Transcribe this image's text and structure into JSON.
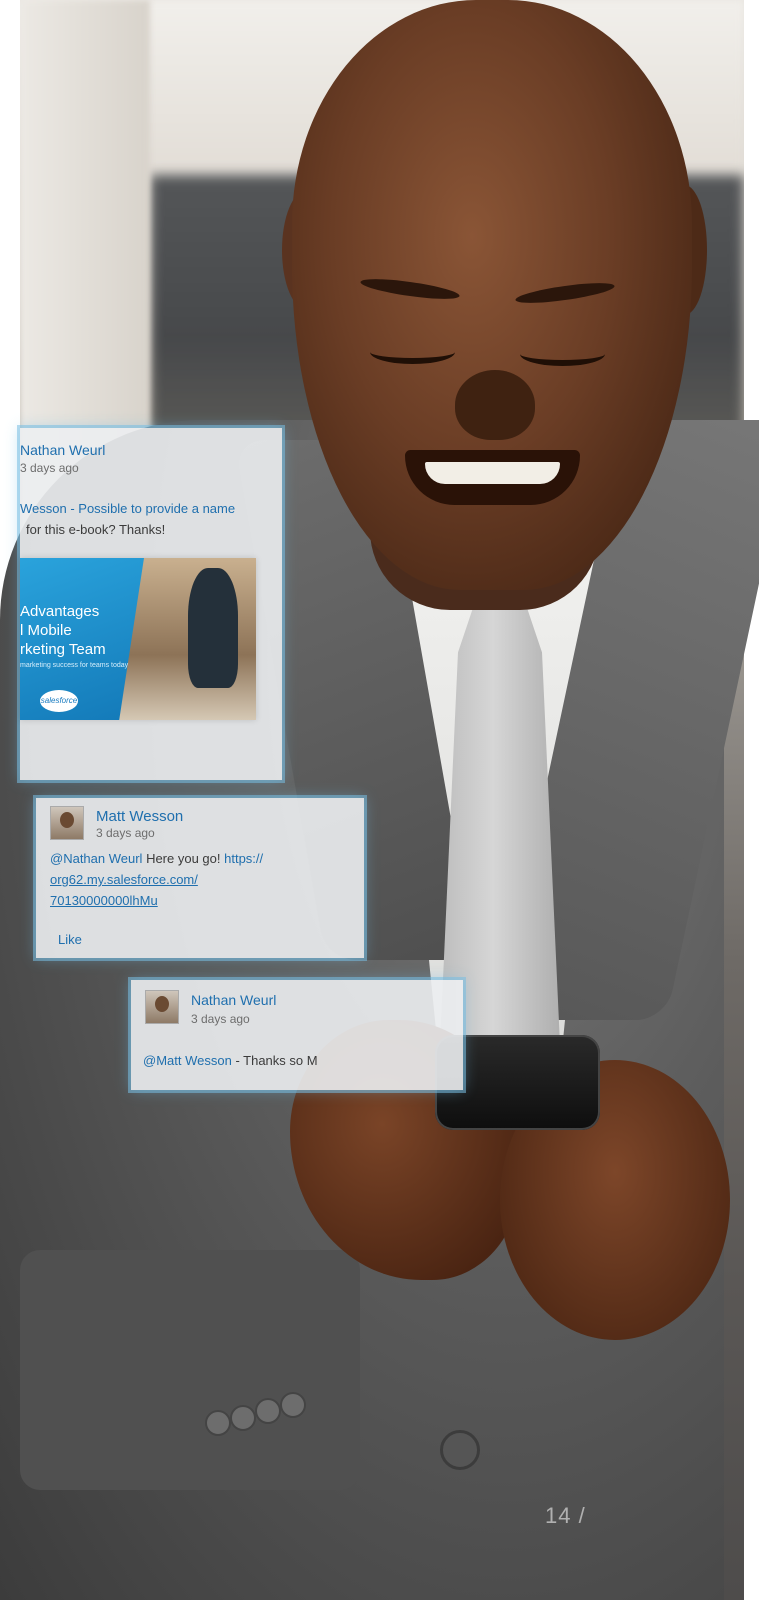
{
  "posts": [
    {
      "author": "Nathan Weurl",
      "time": "3 days ago",
      "text_line1": "Wesson - Possible to provide a name",
      "text_line2": "for this e-book?  Thanks!",
      "ebook": {
        "title": "Advantages\nl Mobile\nrketing Team",
        "subtitle": "marketing success for teams today",
        "logo": "salesforce"
      }
    },
    {
      "author": "Matt Wesson",
      "time": "3 days ago",
      "mention": "@Nathan Weurl",
      "text": " Here you go! ",
      "link_line1": "https://",
      "link_line2": "org62.my.salesforce.com/",
      "link_line3": "70130000000lhMu",
      "like_label": "Like"
    },
    {
      "author": "Nathan Weurl",
      "time": "3 days ago",
      "mention": "@Matt Wesson",
      "text": " - Thanks so M"
    }
  ],
  "page_number": "14 /"
}
